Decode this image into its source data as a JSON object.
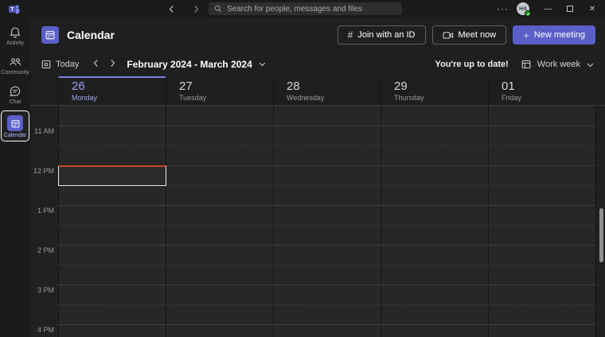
{
  "topbar": {
    "search_placeholder": "Search for people, messages and files",
    "avatar_initials": "HA"
  },
  "rail": {
    "items": [
      {
        "label": "Activity"
      },
      {
        "label": "Community"
      },
      {
        "label": "Chat"
      },
      {
        "label": "Calendar"
      }
    ]
  },
  "header": {
    "title": "Calendar",
    "join_id_label": "Join with an ID",
    "meet_now_label": "Meet now",
    "new_meeting_label": "New meeting"
  },
  "toolbar": {
    "today_label": "Today",
    "date_range": "February 2024 - March 2024",
    "status_text": "You're up to date!",
    "view_label": "Work week"
  },
  "calendar": {
    "days": [
      {
        "number": "26",
        "name": "Monday",
        "active": true
      },
      {
        "number": "27",
        "name": "Tuesday",
        "active": false
      },
      {
        "number": "28",
        "name": "Wednesday",
        "active": false
      },
      {
        "number": "29",
        "name": "Thursday",
        "active": false
      },
      {
        "number": "01",
        "name": "Friday",
        "active": false
      }
    ],
    "times": [
      "11 AM",
      "12 PM",
      "1 PM",
      "2 PM",
      "3 PM",
      "4 PM"
    ]
  },
  "glyphs": {
    "hash": "#",
    "plus": "+",
    "more": "···",
    "minimize": "—",
    "close": "✕"
  },
  "colors": {
    "accent": "#5b5fc7",
    "active_day_text": "#9fa3f3",
    "active_day_border": "#7b80e0",
    "selected_slot_top_line": "#c4452c",
    "presence_available": "#13a10e"
  }
}
